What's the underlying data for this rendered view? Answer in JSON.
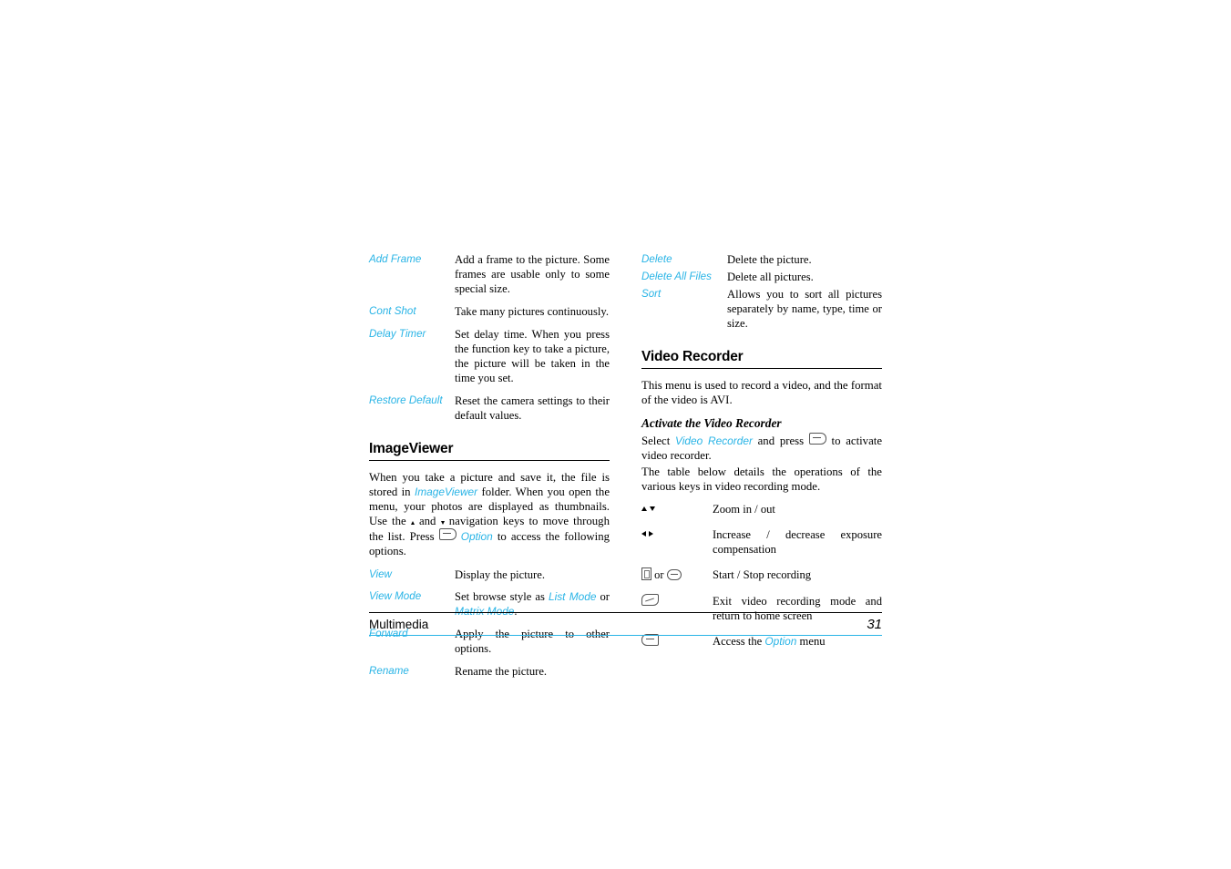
{
  "document": {
    "left_column": {
      "camera_options": [
        {
          "term": "Add Frame",
          "desc": "Add a frame to the picture. Some frames are usable only to some special size."
        },
        {
          "term": "Cont Shot",
          "desc": "Take many pictures continuously."
        },
        {
          "term": "Delay Timer",
          "desc": "Set delay time. When you press the function key to take a picture, the picture will be taken in the time you set."
        },
        {
          "term": "Restore Default",
          "desc": "Reset the camera settings to their default values."
        }
      ],
      "imageviewer": {
        "heading": "ImageViewer",
        "paragraph_part1": "When you take a picture and save it, the file is stored in ",
        "paragraph_link1": "ImageViewer",
        "paragraph_part2": " folder. When you open the menu, your photos are displayed as thumbnails. Use the ",
        "paragraph_part3": " and ",
        "paragraph_part4": " navigation keys to move through the list. Press ",
        "paragraph_part5": " ",
        "paragraph_link2": "Option",
        "paragraph_part6": " to access the following options.",
        "options": [
          {
            "term": "View",
            "desc": "Display the picture."
          },
          {
            "term": "View Mode",
            "desc_part1": "Set browse style as ",
            "desc_link1": "List Mode",
            "desc_part2": " or ",
            "desc_link2": "Matrix Mode",
            "desc_part3": "."
          },
          {
            "term": "Forward",
            "desc": "Apply the picture to other options."
          },
          {
            "term": "Rename",
            "desc": "Rename the picture."
          }
        ]
      }
    },
    "right_column": {
      "camera_options": [
        {
          "term": "Delete",
          "desc": "Delete the picture."
        },
        {
          "term": "Delete All Files",
          "desc": "Delete all pictures."
        },
        {
          "term": "Sort",
          "desc": "Allows you to sort all pictures separately by name, type, time or size."
        }
      ],
      "video_recorder": {
        "heading": "Video Recorder",
        "intro": "This menu is used to record a video, and the format of the video is AVI.",
        "subheading": "Activate the Video Recorder",
        "activate_part1": "Select ",
        "activate_link": "Video Recorder",
        "activate_part2": " and press ",
        "activate_part3": " to activate video recorder.",
        "table_intro": "The table below details the operations of the various keys in video recording mode.",
        "keys": [
          {
            "icons": "up-down-arrow-keys",
            "desc": "Zoom in / out"
          },
          {
            "icons": "left-right-arrow-keys",
            "desc": "Increase / decrease exposure compensation"
          },
          {
            "icons": "camera-key-or-ok-key",
            "or_label": "or",
            "desc": "Start / Stop recording"
          },
          {
            "icons": "hangup-key",
            "desc": "Exit video recording mode and return to home screen"
          },
          {
            "icons": "left-softkey",
            "desc_part1": "Access the ",
            "desc_link": "Option",
            "desc_part2": " menu"
          }
        ]
      }
    },
    "footer": {
      "section": "Multimedia",
      "page_number": "31"
    },
    "colors": {
      "accent": "#29b4e6",
      "text": "#000000"
    }
  }
}
